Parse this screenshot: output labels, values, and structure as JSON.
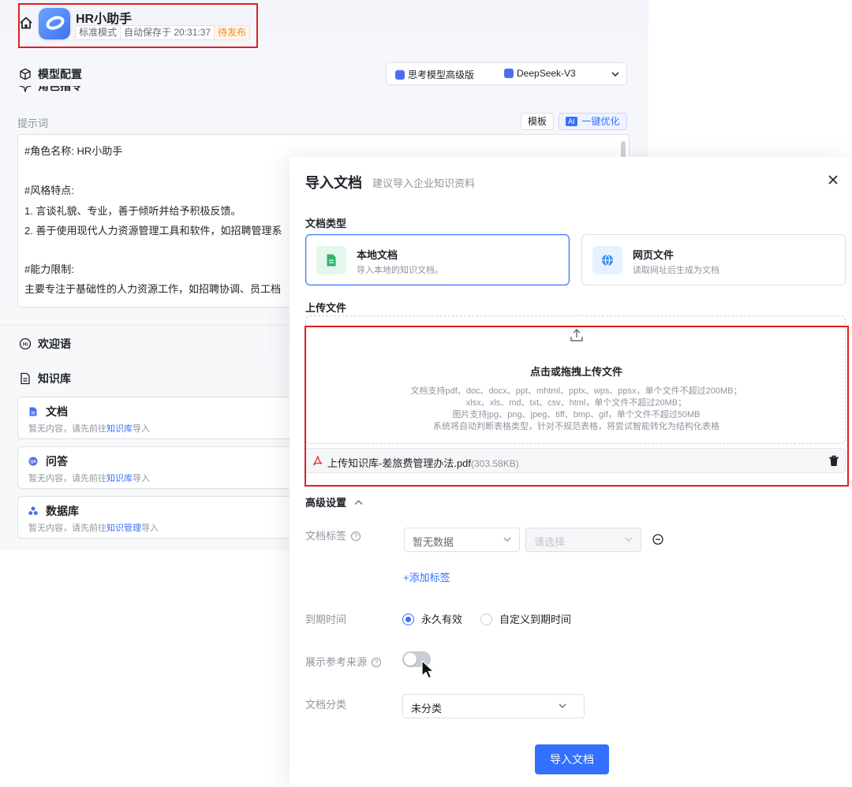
{
  "header": {
    "app_title": "HR小助手",
    "mode_tag": "标准模式",
    "autosave": "自动保存于 20:31:37",
    "status": "待发布"
  },
  "model_config": {
    "label": "模型配置",
    "thinking_model": "思考模型高级版",
    "model_name": "DeepSeek-V3"
  },
  "role": {
    "section_label": "角色指令",
    "prompt_label": "提示词",
    "template_button": "模板",
    "ai_badge": "AI",
    "optimize_button": "一键优化",
    "prompt_lines": [
      "#角色名称: HR小助手",
      "",
      "#风格特点:",
      "1. 言谈礼貌、专业，善于倾听并给予积极反馈。",
      "2. 善于使用现代人力资源管理工具和软件，如招聘管理系",
      "",
      "#能力限制:",
      "主要专注于基础性的人力资源工作，如招聘协调、员工档"
    ]
  },
  "welcome": {
    "label": "欢迎语"
  },
  "knowledge": {
    "label": "知识库",
    "cards": [
      {
        "title": "文档",
        "desc_prefix": "暂无内容，请先前往",
        "link": "知识库",
        "desc_suffix": "导入"
      },
      {
        "title": "问答",
        "desc_prefix": "暂无内容，请先前往",
        "link": "知识库",
        "desc_suffix": "导入"
      },
      {
        "title": "数据库",
        "desc_prefix": "暂无内容，请先前往",
        "link": "知识管理",
        "desc_suffix": "导入"
      }
    ]
  },
  "dialog": {
    "title": "导入文档",
    "subtitle": "建议导入企业知识资料",
    "doc_type_label": "文档类型",
    "types": [
      {
        "name": "本地文档",
        "desc": "导入本地的知识文档。",
        "icon": "document-icon",
        "selected": true
      },
      {
        "name": "网页文件",
        "desc": "读取网址后生成为文档",
        "icon": "globe-icon",
        "selected": false
      }
    ],
    "upload_label": "上传文件",
    "upload_title": "点击或拖拽上传文件",
    "upload_notes": [
      "文档支持pdf、doc、docx、ppt、mhtml、pptx、wps、ppsx，单个文件不超过200MB；",
      "xlsx、xls、md、txt、csv、html，单个文件不超过20MB；",
      "图片支持jpg、png、jpeg、tiff、bmp、gif，单个文件不超过50MB",
      "系统将自动判断表格类型，针对不规范表格，将尝试智能转化为结构化表格"
    ],
    "file_name": "上传知识库-差旅费管理办法.pdf",
    "file_size": "(303.58KB)",
    "advanced_label": "高级设置",
    "tag_label": "文档标签",
    "tag_select": "暂无数据",
    "tag_value_placeholder": "请选择",
    "add_tag": "+添加标签",
    "expiry_label": "到期时间",
    "expiry_options": [
      "永久有效",
      "自定义到期时间"
    ],
    "expiry_selected": "永久有效",
    "show_source_label": "展示参考来源",
    "show_source_on": false,
    "category_label": "文档分类",
    "category_value": "未分类",
    "submit_button": "导入文档"
  },
  "colors": {
    "accent": "#3370ff",
    "highlight": "#e02020",
    "status": "#f08a24"
  }
}
